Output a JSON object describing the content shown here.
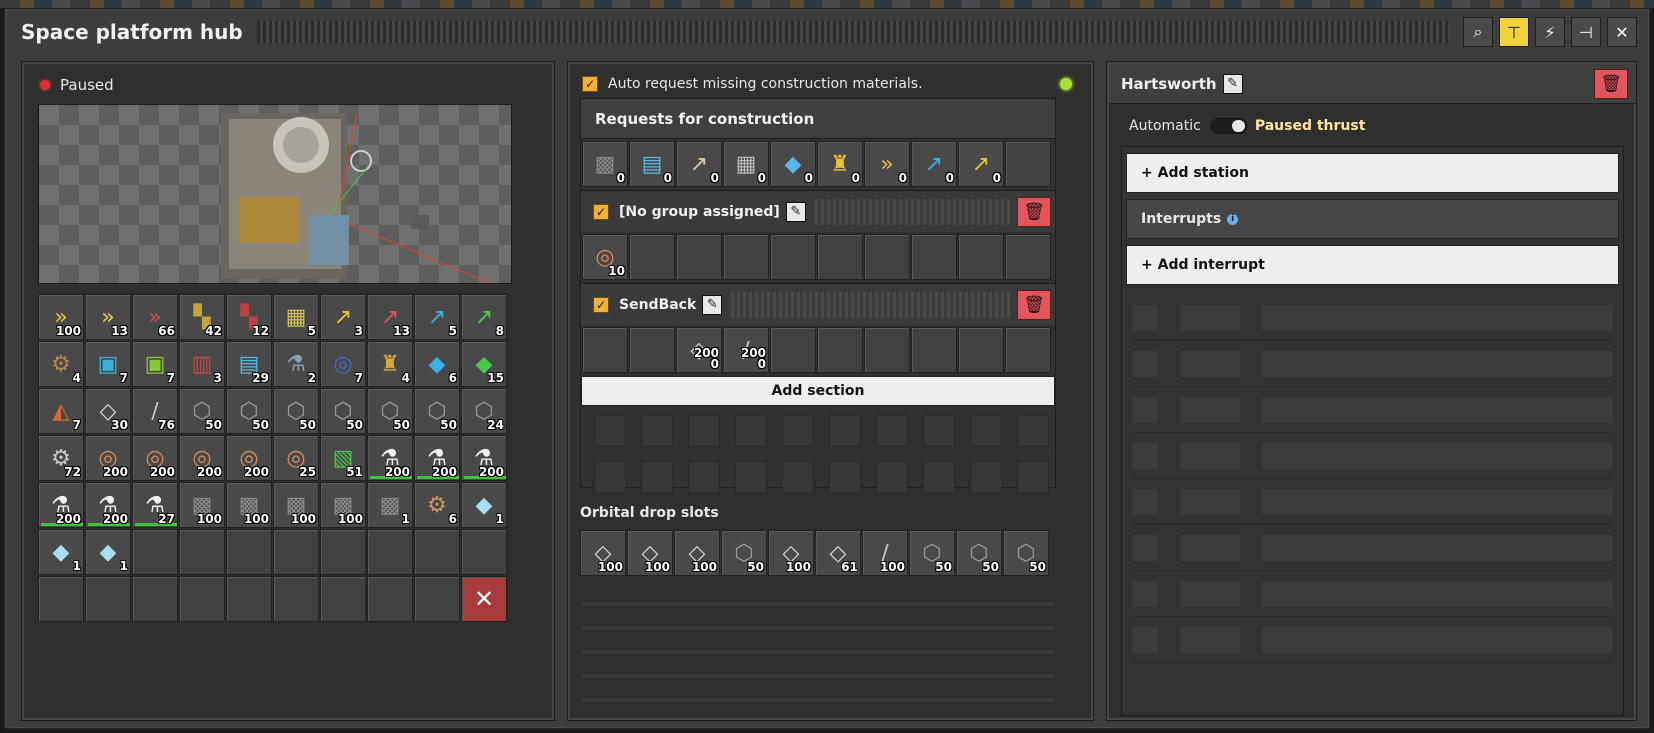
{
  "window": {
    "title": "Space platform hub",
    "title_buttons": [
      {
        "icon": "magnifier-icon",
        "glyph": "⌕",
        "active": false
      },
      {
        "icon": "network-tree-icon",
        "glyph": "⊤",
        "active": true
      },
      {
        "icon": "lightning-icon",
        "glyph": "⚡",
        "active": false
      },
      {
        "icon": "pin-icon",
        "glyph": "⊣",
        "active": false
      },
      {
        "icon": "close-icon",
        "glyph": "✕",
        "active": false
      }
    ]
  },
  "status": {
    "text": "Paused",
    "color": "#e03030"
  },
  "inventory": {
    "slots": [
      {
        "icon": "transport-belt-yellow-icon",
        "glyph": "»",
        "color": "#e8c432",
        "qty": "100"
      },
      {
        "icon": "fast-transport-belt-icon",
        "glyph": "»",
        "color": "#e8d052",
        "qty": "13"
      },
      {
        "icon": "express-transport-belt-icon",
        "glyph": "»",
        "color": "#d84a4a",
        "qty": "66"
      },
      {
        "icon": "underground-belt-yellow-icon",
        "glyph": "▚",
        "color": "#c9a23a",
        "qty": "42"
      },
      {
        "icon": "underground-belt-red-icon",
        "glyph": "▚",
        "color": "#c04040",
        "qty": "12"
      },
      {
        "icon": "splitter-icon",
        "glyph": "▦",
        "color": "#d8c050",
        "qty": "5"
      },
      {
        "icon": "inserter-icon",
        "glyph": "↗",
        "color": "#e8c832",
        "qty": "3"
      },
      {
        "icon": "fast-inserter-icon",
        "glyph": "↗",
        "color": "#e05050",
        "qty": "13"
      },
      {
        "icon": "stack-inserter-icon",
        "glyph": "↗",
        "color": "#3ab0d8",
        "qty": "5"
      },
      {
        "icon": "bulk-inserter-icon",
        "glyph": "↗",
        "color": "#50c850",
        "qty": "8"
      },
      {
        "icon": "crusher-icon",
        "glyph": "⚙",
        "color": "#b08a50",
        "qty": "4"
      },
      {
        "icon": "assembler-blue-icon",
        "glyph": "▣",
        "color": "#3ab0d8",
        "qty": "7"
      },
      {
        "icon": "assembler-green-icon",
        "glyph": "▣",
        "color": "#8ac83a",
        "qty": "7"
      },
      {
        "icon": "foundry-icon",
        "glyph": "▥",
        "color": "#c04848",
        "qty": "3"
      },
      {
        "icon": "solar-panel-icon",
        "glyph": "▤",
        "color": "#5ab8e8",
        "qty": "29"
      },
      {
        "icon": "chemical-plant-icon",
        "glyph": "⚗",
        "color": "#8aa0b8",
        "qty": "2"
      },
      {
        "icon": "radar-icon",
        "glyph": "◎",
        "color": "#4868c8",
        "qty": "7"
      },
      {
        "icon": "thruster-icon",
        "glyph": "♜",
        "color": "#d8a840",
        "qty": "4"
      },
      {
        "icon": "asteroid-collector-icon",
        "glyph": "◆",
        "color": "#3ab0e8",
        "qty": "6"
      },
      {
        "icon": "cargo-bay-icon",
        "glyph": "◆",
        "color": "#48c848",
        "qty": "15"
      },
      {
        "icon": "medium-pole-icon",
        "glyph": "◭",
        "color": "#d86838",
        "qty": "7"
      },
      {
        "icon": "iron-plate-icon",
        "glyph": "◇",
        "color": "#d8d8d8",
        "qty": "30"
      },
      {
        "icon": "steel-beam-icon",
        "glyph": "∕",
        "color": "#c8c8c8",
        "qty": "76"
      },
      {
        "icon": "stone-brick-icon",
        "glyph": "⬡",
        "color": "#9a9a9a",
        "qty": "50"
      },
      {
        "icon": "stone-brick-icon",
        "glyph": "⬡",
        "color": "#9a9a9a",
        "qty": "50"
      },
      {
        "icon": "stone-brick-icon",
        "glyph": "⬡",
        "color": "#9a9a9a",
        "qty": "50"
      },
      {
        "icon": "stone-brick-icon",
        "glyph": "⬡",
        "color": "#9a9a9a",
        "qty": "50"
      },
      {
        "icon": "stone-brick-icon",
        "glyph": "⬡",
        "color": "#9a9a9a",
        "qty": "50"
      },
      {
        "icon": "stone-brick-icon",
        "glyph": "⬡",
        "color": "#9a9a9a",
        "qty": "50"
      },
      {
        "icon": "stone-brick-icon",
        "glyph": "⬡",
        "color": "#9a9a9a",
        "qty": "24"
      },
      {
        "icon": "iron-gear-icon",
        "glyph": "⚙",
        "color": "#c8c8c8",
        "qty": "72"
      },
      {
        "icon": "copper-cable-icon",
        "glyph": "◎",
        "color": "#d88a5a",
        "qty": "200"
      },
      {
        "icon": "copper-cable-icon",
        "glyph": "◎",
        "color": "#d88a5a",
        "qty": "200"
      },
      {
        "icon": "copper-cable-icon",
        "glyph": "◎",
        "color": "#d88a5a",
        "qty": "200"
      },
      {
        "icon": "copper-cable-icon",
        "glyph": "◎",
        "color": "#d88a5a",
        "qty": "200"
      },
      {
        "icon": "copper-cable-icon",
        "glyph": "◎",
        "color": "#d88a5a",
        "qty": "25"
      },
      {
        "icon": "electronic-circuit-icon",
        "glyph": "▧",
        "color": "#48c848",
        "qty": "51"
      },
      {
        "icon": "science-flask-icon",
        "glyph": "⚗",
        "color": "#f0f0f0",
        "qty": "200",
        "bar": 1.0
      },
      {
        "icon": "science-flask-icon",
        "glyph": "⚗",
        "color": "#f0f0f0",
        "qty": "200",
        "bar": 1.0
      },
      {
        "icon": "science-flask-icon",
        "glyph": "⚗",
        "color": "#f0f0f0",
        "qty": "200",
        "bar": 1.0
      },
      {
        "icon": "science-flask-icon",
        "glyph": "⚗",
        "color": "#f0f0f0",
        "qty": "200",
        "bar": 1.0
      },
      {
        "icon": "science-flask-icon",
        "glyph": "⚗",
        "color": "#f0f0f0",
        "qty": "200",
        "bar": 1.0
      },
      {
        "icon": "science-flask-icon",
        "glyph": "⚗",
        "color": "#f0f0f0",
        "qty": "27",
        "bar": 1.0
      },
      {
        "icon": "space-platform-foundation-icon",
        "glyph": "▩",
        "color": "#8a8a8a",
        "qty": "100"
      },
      {
        "icon": "space-platform-foundation-icon",
        "glyph": "▩",
        "color": "#8a8a8a",
        "qty": "100"
      },
      {
        "icon": "space-platform-foundation-icon",
        "glyph": "▩",
        "color": "#8a8a8a",
        "qty": "100"
      },
      {
        "icon": "space-platform-foundation-icon",
        "glyph": "▩",
        "color": "#8a8a8a",
        "qty": "100"
      },
      {
        "icon": "space-platform-foundation-icon",
        "glyph": "▩",
        "color": "#8a8a8a",
        "qty": "1"
      },
      {
        "icon": "asteroid-crusher-icon",
        "glyph": "⚙",
        "color": "#c89a60",
        "qty": "6"
      },
      {
        "icon": "ice-icon",
        "glyph": "◆",
        "color": "#a8e0f0",
        "qty": "1"
      },
      {
        "icon": "ice-icon",
        "glyph": "◆",
        "color": "#a8e0f0",
        "qty": "1"
      },
      {
        "icon": "ice-icon",
        "glyph": "◆",
        "color": "#a8e0f0",
        "qty": "1"
      }
    ],
    "total_slots": 70,
    "trash_icon": "clear-x-icon"
  },
  "middle": {
    "auto_request_label": "Auto request missing construction materials.",
    "requests_title": "Requests for construction",
    "requests": [
      {
        "icon": "space-platform-foundation-icon",
        "glyph": "▩",
        "color": "#8a8a8a",
        "qty": "0"
      },
      {
        "icon": "solar-panel-icon",
        "glyph": "▤",
        "color": "#5ab8e8",
        "qty": "0"
      },
      {
        "icon": "inserter-icon",
        "glyph": "↗",
        "color": "#d8c8a0",
        "qty": "0"
      },
      {
        "icon": "assembler-icon",
        "glyph": "▦",
        "color": "#b8b8b8",
        "qty": "0"
      },
      {
        "icon": "asteroid-collector-icon",
        "glyph": "◆",
        "color": "#5ab8e8",
        "qty": "0"
      },
      {
        "icon": "thruster-icon",
        "glyph": "♜",
        "color": "#e8c032",
        "qty": "0"
      },
      {
        "icon": "transport-belt-icon",
        "glyph": "»",
        "color": "#e8c432",
        "qty": "0"
      },
      {
        "icon": "stack-inserter-icon",
        "glyph": "↗",
        "color": "#3ab0d8",
        "qty": "0"
      },
      {
        "icon": "inserter-icon",
        "glyph": "↗",
        "color": "#e8c832",
        "qty": "0"
      }
    ],
    "sections": [
      {
        "name": "[No group assigned]",
        "slots": [
          {
            "position": 0,
            "icon": "copper-cable-icon",
            "glyph": "◎",
            "color": "#d88a5a",
            "qty": "10"
          }
        ]
      },
      {
        "name": "SendBack",
        "slots": [
          {
            "position": 2,
            "icon": "iron-plate-icon",
            "glyph": "◇",
            "color": "#d8d8d8",
            "qty": "200",
            "sub": "0"
          },
          {
            "position": 3,
            "icon": "steel-beam-icon",
            "glyph": "∕",
            "color": "#c8c8c8",
            "qty": "200",
            "sub": "0"
          }
        ]
      }
    ],
    "add_section_label": "Add section",
    "orbital_title": "Orbital drop slots",
    "orbital": [
      {
        "icon": "iron-plate-icon",
        "glyph": "◇",
        "color": "#d8d8d8",
        "qty": "100"
      },
      {
        "icon": "iron-plate-icon",
        "glyph": "◇",
        "color": "#d8d8d8",
        "qty": "100"
      },
      {
        "icon": "iron-plate-icon",
        "glyph": "◇",
        "color": "#d8d8d8",
        "qty": "100"
      },
      {
        "icon": "stone-brick-icon",
        "glyph": "⬡",
        "color": "#9a9a9a",
        "qty": "50"
      },
      {
        "icon": "iron-plate-icon",
        "glyph": "◇",
        "color": "#d8d8d8",
        "qty": "100"
      },
      {
        "icon": "iron-plate-icon",
        "glyph": "◇",
        "color": "#d8d8d8",
        "qty": "61"
      },
      {
        "icon": "steel-beam-icon",
        "glyph": "∕",
        "color": "#c8c8c8",
        "qty": "100"
      },
      {
        "icon": "stone-brick-icon",
        "glyph": "⬡",
        "color": "#9a9a9a",
        "qty": "50"
      },
      {
        "icon": "stone-brick-icon",
        "glyph": "⬡",
        "color": "#9a9a9a",
        "qty": "50"
      },
      {
        "icon": "stone-brick-icon",
        "glyph": "⬡",
        "color": "#9a9a9a",
        "qty": "50"
      }
    ]
  },
  "right": {
    "platform_name": "Hartsworth",
    "automatic_label": "Automatic",
    "paused_thrust_label": "Paused thrust",
    "add_station_label": "+ Add station",
    "interrupts_label": "Interrupts",
    "add_interrupt_label": "+ Add interrupt",
    "accent": "#ffe6a0"
  }
}
